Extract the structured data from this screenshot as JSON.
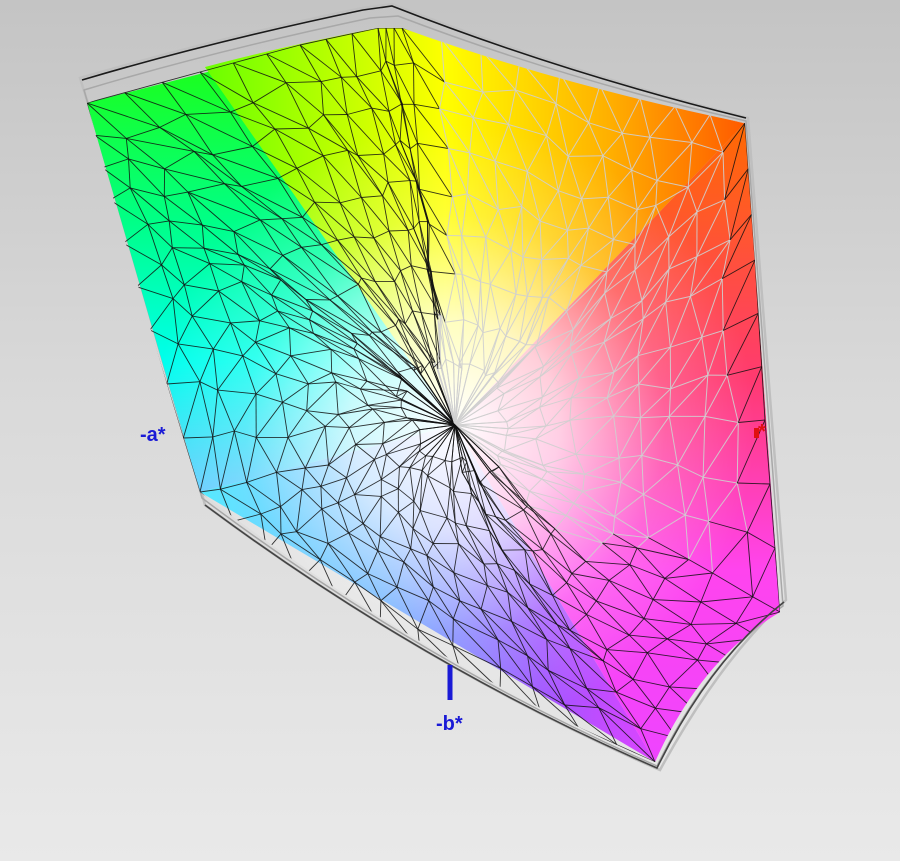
{
  "axes": {
    "neg_a": {
      "label": "-a*",
      "color": "#1a1ad6"
    },
    "neg_b": {
      "label": "-b*",
      "color": "#1a1ad6"
    },
    "pos_a": {
      "label": "*",
      "color": "#e01010"
    }
  },
  "colors": {
    "background_top": "#c4c4c4",
    "background_bottom": "#e9e9e9",
    "mesh_dark": "#111111",
    "mesh_light": "#cfcfcf",
    "green": "#22ff00",
    "yellow": "#ffff00",
    "orange": "#ff6a00",
    "red": "#ff3355",
    "magenta": "#ff33ff",
    "cyan": "#00ffee",
    "blue": "#3aa0ff",
    "violet": "#a44dff",
    "white": "#ffffff"
  }
}
